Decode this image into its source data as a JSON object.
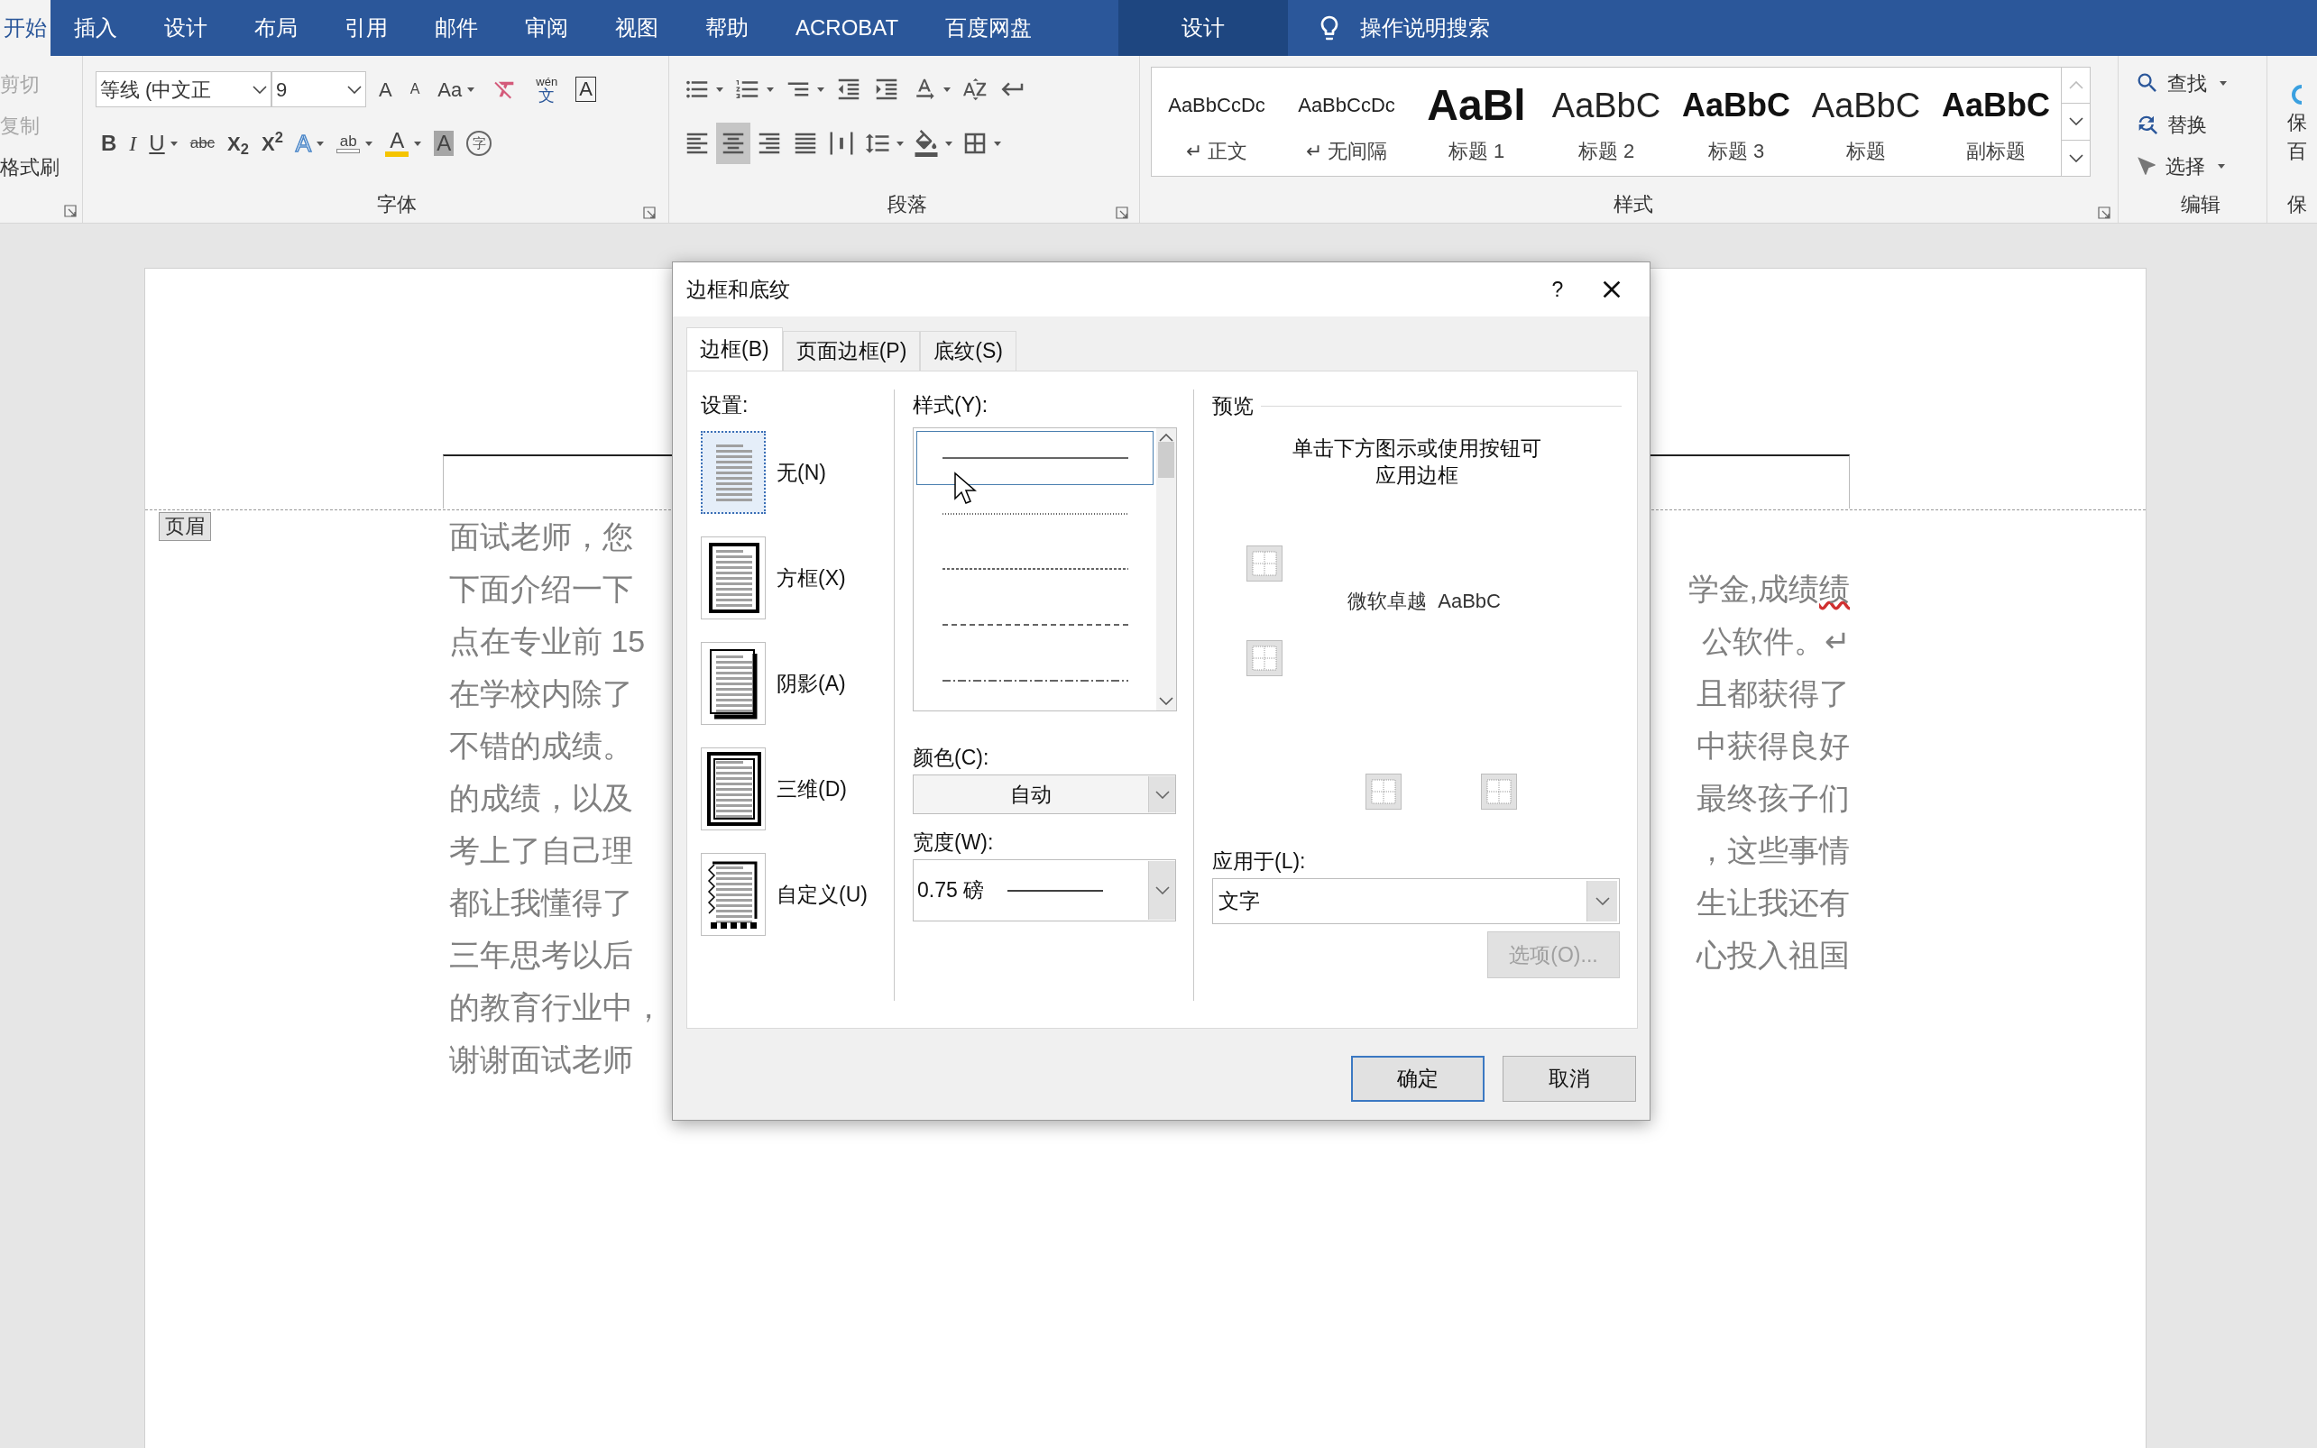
{
  "tabs": [
    {
      "label": "开始",
      "selected": true
    },
    {
      "label": "插入",
      "selected": false
    },
    {
      "label": "设计",
      "selected": false
    },
    {
      "label": "布局",
      "selected": false
    },
    {
      "label": "引用",
      "selected": false
    },
    {
      "label": "邮件",
      "selected": false
    },
    {
      "label": "审阅",
      "selected": false
    },
    {
      "label": "视图",
      "selected": false
    },
    {
      "label": "帮助",
      "selected": false
    },
    {
      "label": "ACROBAT",
      "selected": false
    },
    {
      "label": "百度网盘",
      "selected": false
    }
  ],
  "context_tab": {
    "label": "设计"
  },
  "tell_me": {
    "label": "操作说明搜索"
  },
  "clipboard": {
    "items": [
      {
        "label": "剪切",
        "disabled": true
      },
      {
        "label": "复制",
        "disabled": true
      },
      {
        "label": "格式刷",
        "disabled": false
      }
    ]
  },
  "font_group": {
    "label": "字体",
    "font_name": "等线 (中文正",
    "font_size": "9",
    "row1": [
      {
        "kind": "grow",
        "text": "A",
        "dropdown": false
      },
      {
        "kind": "shrink",
        "text": "A",
        "dropdown": false
      },
      {
        "kind": "case",
        "text": "Aa",
        "dropdown": true
      },
      {
        "kind": "clear",
        "dropdown": false
      },
      {
        "kind": "phonetic",
        "text": "wén",
        "text2": "文",
        "dropdown": false
      },
      {
        "kind": "charborder",
        "text": "A",
        "dropdown": false
      }
    ],
    "row2": [
      {
        "kind": "bold",
        "text": "B",
        "dropdown": false
      },
      {
        "kind": "italic",
        "text": "I",
        "dropdown": false
      },
      {
        "kind": "underline",
        "text": "U",
        "dropdown": true
      },
      {
        "kind": "strike",
        "text": "abc",
        "dropdown": false
      },
      {
        "kind": "sub",
        "text": "X$_{2}$",
        "dropdown": false
      },
      {
        "kind": "super",
        "text": "X$^{2}$",
        "dropdown": false
      },
      {
        "kind": "effects",
        "text": "A",
        "dropdown": true
      },
      {
        "kind": "highlight",
        "text": "ab",
        "dropdown": true
      },
      {
        "kind": "color",
        "text": "A",
        "dropdown": true
      },
      {
        "kind": "shading",
        "text": "A",
        "dropdown": false
      },
      {
        "kind": "enclose",
        "text": "字",
        "dropdown": false
      }
    ]
  },
  "paragraph_group": {
    "label": "段落",
    "row1": [
      {
        "kind": "bullets",
        "dropdown": true
      },
      {
        "kind": "numbering",
        "dropdown": true
      },
      {
        "kind": "multilevel",
        "dropdown": true
      },
      {
        "kind": "indent-decrease",
        "dropdown": false
      },
      {
        "kind": "indent-increase",
        "dropdown": false
      },
      {
        "kind": "text-direction",
        "dropdown": true
      },
      {
        "kind": "sort",
        "dropdown": false
      },
      {
        "kind": "marks",
        "dropdown": false
      }
    ],
    "row2": [
      {
        "kind": "align-left",
        "dropdown": false,
        "selected": false
      },
      {
        "kind": "align-center",
        "dropdown": false,
        "selected": true
      },
      {
        "kind": "align-right",
        "dropdown": false,
        "selected": false
      },
      {
        "kind": "justify",
        "dropdown": false,
        "selected": false
      },
      {
        "kind": "distributed",
        "dropdown": false,
        "selected": false
      },
      {
        "kind": "line-spacing",
        "dropdown": true,
        "selected": false
      },
      {
        "kind": "shading",
        "dropdown": true,
        "selected": false
      },
      {
        "kind": "borders",
        "dropdown": true,
        "selected": false
      }
    ]
  },
  "styles_group": {
    "label": "样式",
    "items": [
      {
        "sample": "AaBbCcDc",
        "label": "↵ 正文",
        "kind": "body"
      },
      {
        "sample": "AaBbCcDc",
        "label": "↵ 无间隔",
        "kind": "body"
      },
      {
        "sample": "AaBl",
        "label": "标题 1",
        "kind": "big"
      },
      {
        "sample": "AaBbC",
        "label": "标题 2",
        "kind": "light"
      },
      {
        "sample": "AaBbC",
        "label": "标题 3",
        "kind": "bold"
      },
      {
        "sample": "AaBbC",
        "label": "标题",
        "kind": "light"
      },
      {
        "sample": "AaBbC",
        "label": "副标题",
        "kind": "bold"
      }
    ]
  },
  "editing_group": {
    "label": "编辑",
    "items": [
      {
        "kind": "find",
        "label": "查找",
        "dropdown": true
      },
      {
        "kind": "replace",
        "label": "替换",
        "dropdown": false
      },
      {
        "kind": "select",
        "label": "选择",
        "dropdown": true
      }
    ]
  },
  "partial_group": {
    "lines": [
      "保",
      "百"
    ],
    "label": "保"
  },
  "document": {
    "header_tag": "页眉",
    "lines": [
      {
        "left": "面试老师，您"
      },
      {
        "left": "下面介绍一下",
        "right": "学金,成绩",
        "flagged": "绩"
      },
      {
        "left": "点在专业前 15",
        "right": "公软件。↵"
      },
      {
        "left": "在学校内除了",
        "right": "且都获得了"
      },
      {
        "left": "不错的成绩。",
        "right": "中获得良好"
      },
      {
        "left": "的成绩，以及",
        "right": "最终孩子们"
      },
      {
        "left": "考上了自己理",
        "right": "，这些事情"
      },
      {
        "left": "都让我懂得了",
        "right": "生让我还有"
      },
      {
        "left": "三年思考以后",
        "right": "心投入祖国"
      },
      {
        "left": "的教育行业中，"
      },
      {
        "left": "谢谢面试老师"
      }
    ]
  },
  "dialog": {
    "title": "边框和底纹",
    "help": "?",
    "tabs": [
      {
        "label": "边框(B)",
        "selected": true
      },
      {
        "label": "页面边框(P)",
        "selected": false
      },
      {
        "label": "底纹(S)",
        "selected": false
      }
    ],
    "setting": {
      "label": "设置:",
      "items": [
        {
          "kind": "none",
          "label": "无(N)",
          "selected": true
        },
        {
          "kind": "box",
          "label": "方框(X)",
          "selected": false
        },
        {
          "kind": "shadow",
          "label": "阴影(A)",
          "selected": false
        },
        {
          "kind": "framed",
          "label": "三维(D)",
          "selected": false
        },
        {
          "kind": "custom",
          "label": "自定义(U)",
          "selected": false
        }
      ]
    },
    "style": {
      "label": "样式(Y):",
      "items": [
        {
          "kind": "solid",
          "selected": true
        },
        {
          "kind": "dotted",
          "selected": false
        },
        {
          "kind": "fine-dash",
          "selected": false
        },
        {
          "kind": "dash",
          "selected": false
        },
        {
          "kind": "dash-dot",
          "selected": false
        }
      ]
    },
    "color": {
      "label": "颜色(C):",
      "value": "自动"
    },
    "width": {
      "label": "宽度(W):",
      "value": "0.75 磅"
    },
    "preview": {
      "label": "预览",
      "hint_lines": [
        "单击下方图示或使用按钮可",
        "应用边框"
      ],
      "sample": "微软卓越  AaBbC"
    },
    "apply_to": {
      "label": "应用于(L):",
      "value": "文字"
    },
    "options_button": {
      "label": "选项(O)...",
      "disabled": true
    },
    "buttons": [
      {
        "label": "确定",
        "default": true
      },
      {
        "label": "取消",
        "default": false
      }
    ]
  }
}
